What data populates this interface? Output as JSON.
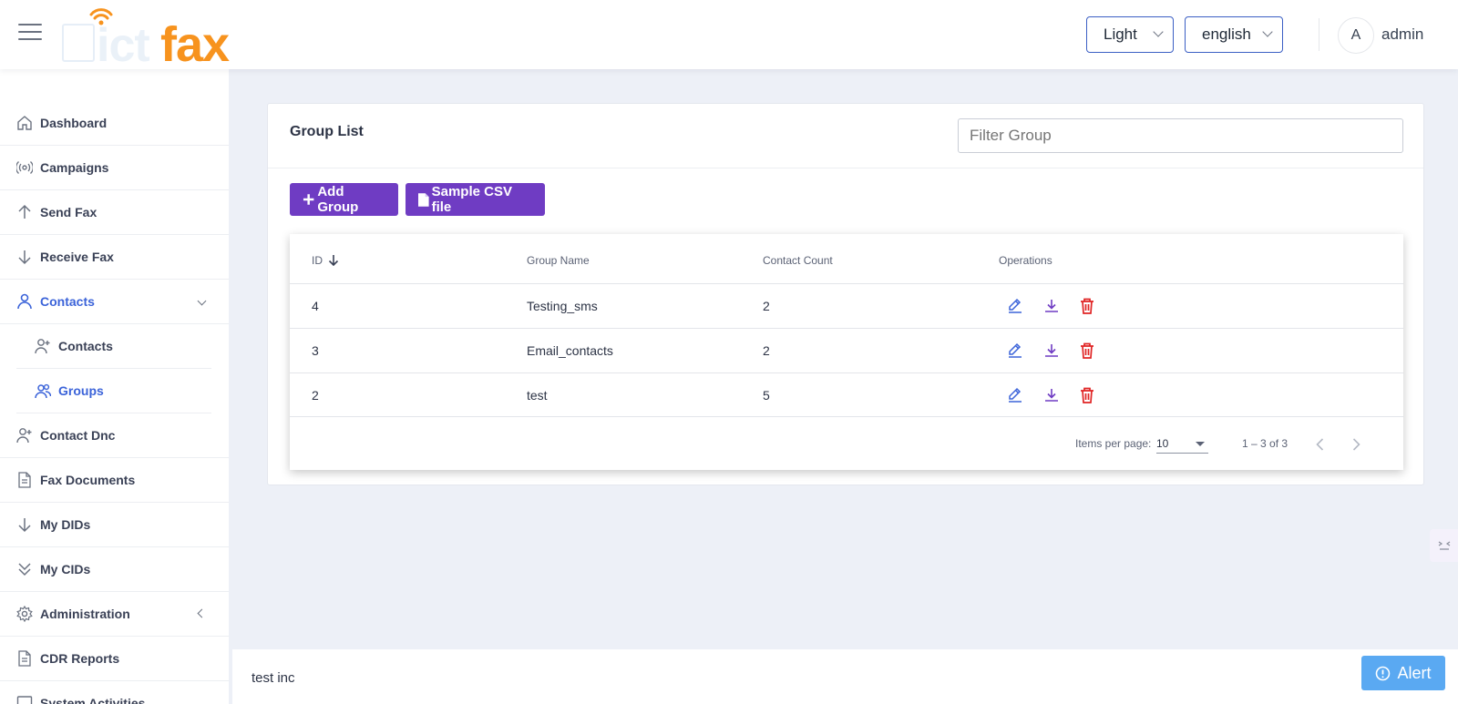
{
  "header": {
    "logo_text": "ictfax",
    "theme_select": "Light",
    "language_select": "english",
    "avatar_initial": "A",
    "username": "admin"
  },
  "sidebar": {
    "items": [
      {
        "label": "Dashboard",
        "icon": "home-icon"
      },
      {
        "label": "Campaigns",
        "icon": "broadcast-icon"
      },
      {
        "label": "Send Fax",
        "icon": "arrow-up-icon"
      },
      {
        "label": "Receive Fax",
        "icon": "arrow-down-icon"
      },
      {
        "label": "Contacts",
        "icon": "person-icon",
        "expanded": true
      },
      {
        "label": "Contacts",
        "icon": "person-add-icon"
      },
      {
        "label": "Groups",
        "icon": "people-icon"
      },
      {
        "label": "Contact Dnc",
        "icon": "person-add-icon"
      },
      {
        "label": "Fax Documents",
        "icon": "file-text-icon"
      },
      {
        "label": "My DIDs",
        "icon": "arrow-down-icon"
      },
      {
        "label": "My CIDs",
        "icon": "double-chevron-down-icon"
      },
      {
        "label": "Administration",
        "icon": "settings-icon"
      },
      {
        "label": "CDR Reports",
        "icon": "file-text-icon"
      },
      {
        "label": "System Activities",
        "icon": "monitor-icon"
      }
    ]
  },
  "main": {
    "title": "Group List",
    "filter_placeholder": "Filter Group",
    "add_button": "Add Group",
    "csv_button": "Sample CSV file",
    "columns": [
      "ID",
      "Group Name",
      "Contact Count",
      "Operations"
    ],
    "rows": [
      {
        "id": "4",
        "name": "Testing_sms",
        "count": "2"
      },
      {
        "id": "3",
        "name": "Email_contacts",
        "count": "2"
      },
      {
        "id": "2",
        "name": "test",
        "count": "5"
      }
    ],
    "pagination": {
      "items_per_page_label": "Items per page:",
      "items_per_page": "10",
      "range": "1 – 3 of 3"
    }
  },
  "footer": {
    "company": "test inc",
    "alert_button": "Alert"
  },
  "colors": {
    "accent": "#6f3cc3",
    "active_nav": "#3b63d9",
    "brand": "#f7931e",
    "alert": "#5aa9f2",
    "delete": "#e02424"
  }
}
